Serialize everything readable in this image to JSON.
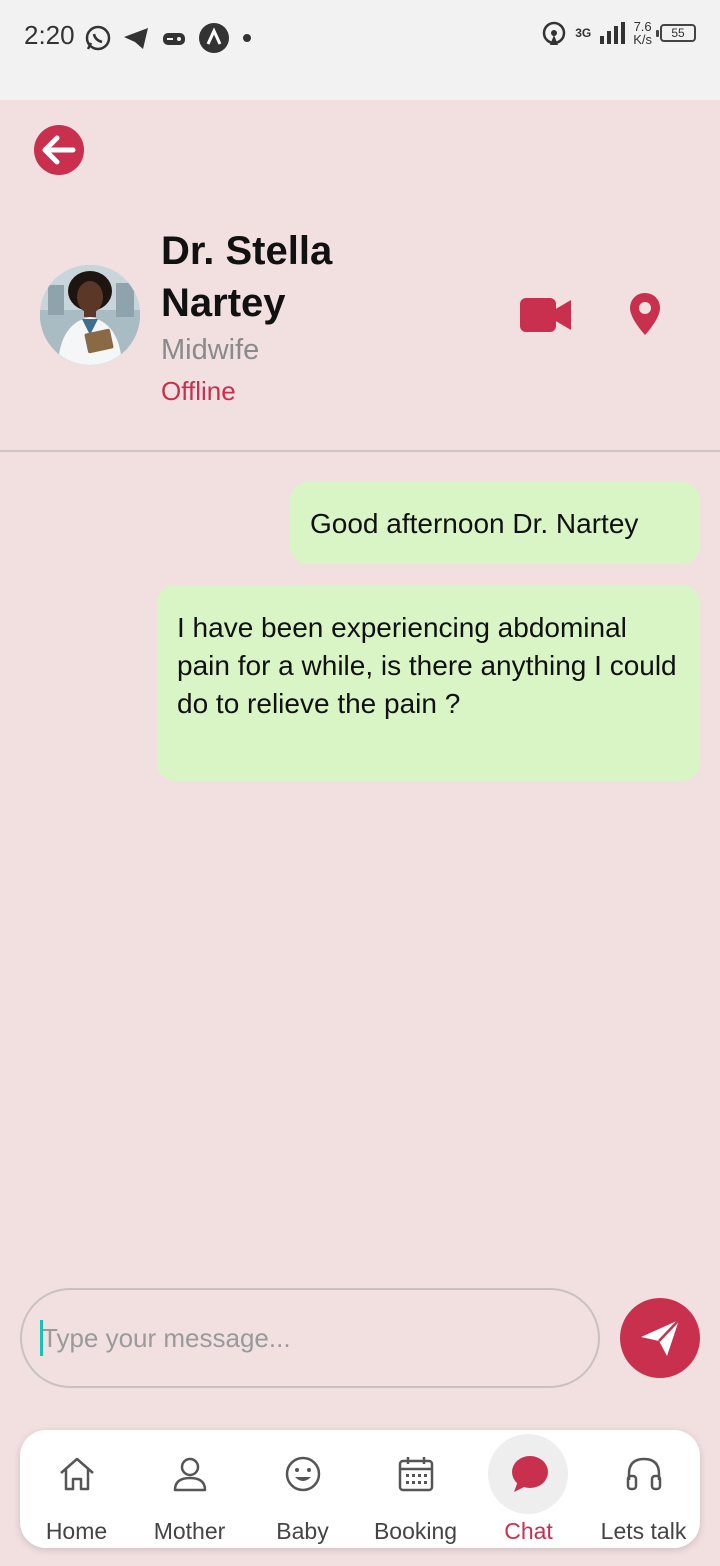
{
  "status_bar": {
    "time": "2:20",
    "network_type": "3G",
    "net_speed_value": "7.6",
    "net_speed_unit": "K/s",
    "battery": "55"
  },
  "header": {
    "doctor_name": "Dr. Stella Nartey",
    "role": "Midwife",
    "status": "Offline"
  },
  "messages": [
    {
      "text": "Good afternoon Dr. Nartey"
    },
    {
      "text": "I have been experiencing abdominal pain for a while, is there anything I could do to relieve the pain ?"
    }
  ],
  "composer": {
    "placeholder": "Type your message..."
  },
  "nav": {
    "items": [
      {
        "label": "Home",
        "icon": "home-icon"
      },
      {
        "label": "Mother",
        "icon": "person-icon"
      },
      {
        "label": "Baby",
        "icon": "smiley-icon"
      },
      {
        "label": "Booking",
        "icon": "calendar-icon"
      },
      {
        "label": "Chat",
        "icon": "chat-icon",
        "active": true
      },
      {
        "label": "Lets talk",
        "icon": "headphones-icon"
      }
    ]
  },
  "colors": {
    "accent": "#c8304e",
    "background": "#f2e0e1",
    "bubble": "#d9f5c6"
  }
}
